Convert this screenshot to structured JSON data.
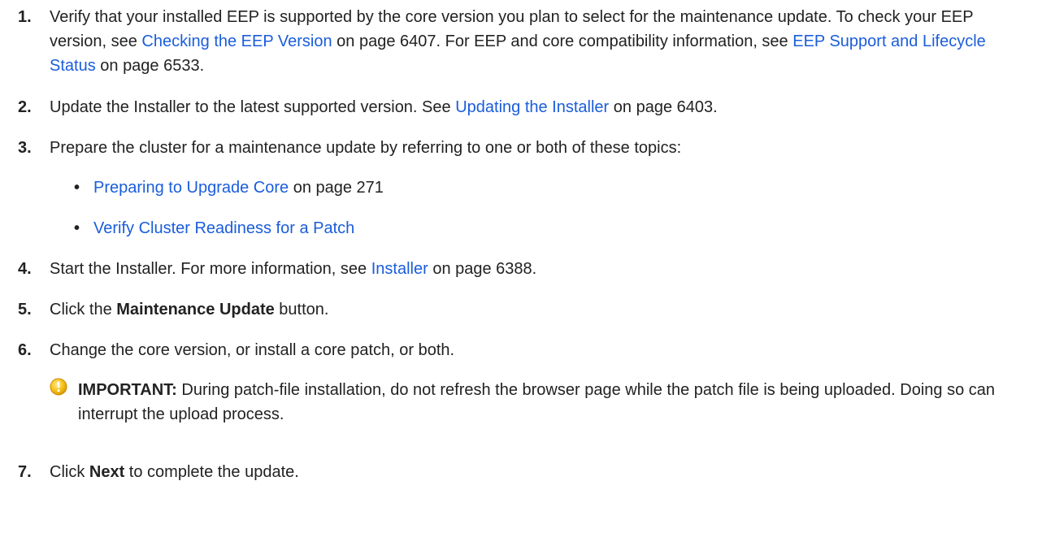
{
  "steps": [
    {
      "num": "1.",
      "pre": "Verify that your installed EEP is supported by the core version you plan to select for the maintenance update. To check your EEP version, see ",
      "link1": "Checking the EEP Version",
      "mid": " on page 6407. For EEP and core compatibility information, see ",
      "link2": "EEP Support and Lifecycle Status",
      "post": " on page 6533."
    },
    {
      "num": "2.",
      "pre": "Update the Installer to the latest supported version. See ",
      "link": "Updating the Installer",
      "post": " on page 6403."
    },
    {
      "num": "3.",
      "text": "Prepare the cluster for a maintenance update by referring to one or both of these topics:"
    },
    {
      "num": "4.",
      "pre": "Start the Installer. For more information, see ",
      "link": "Installer",
      "post": " on page 6388."
    },
    {
      "num": "5.",
      "pre": "Click the ",
      "bold": "Maintenance Update",
      "post": " button."
    },
    {
      "num": "6.",
      "text": "Change the core version, or install a core patch, or both."
    },
    {
      "num": "7.",
      "pre": "Click ",
      "bold": "Next",
      "post": " to complete the update."
    }
  ],
  "bullets": [
    {
      "link": "Preparing to Upgrade Core",
      "post": " on page 271"
    },
    {
      "link": "Verify Cluster Readiness for a Patch",
      "post": ""
    }
  ],
  "note": {
    "label": "IMPORTANT:",
    "text": " During patch-file installation, do not refresh the browser page while the patch file is being uploaded. Doing so can interrupt the upload process.",
    "icon": "warning-icon"
  },
  "colors": {
    "link": "#1a5ddb",
    "text": "#222222",
    "warning": "#f2b705"
  }
}
